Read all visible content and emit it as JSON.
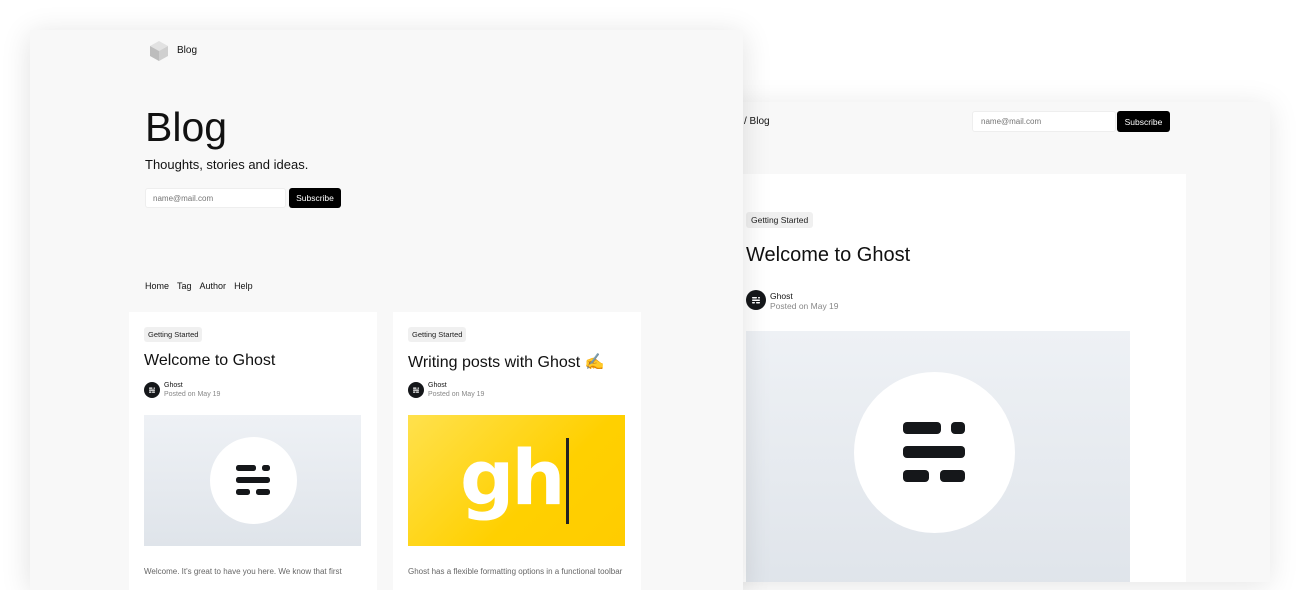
{
  "back_window": {
    "breadcrumb": "/ Blog",
    "subscribe": {
      "placeholder": "name@mail.com",
      "button": "Subscribe"
    },
    "post": {
      "tag": "Getting Started",
      "title": "Welcome to Ghost",
      "author": "Ghost",
      "date": "Posted on May 19",
      "image_icon": "ghost-logo-icon"
    }
  },
  "front_window": {
    "logo_icon": "cube-logo-icon",
    "logo_text": "Blog",
    "title": "Blog",
    "subtitle": "Thoughts, stories and ideas.",
    "subscribe": {
      "placeholder": "name@mail.com",
      "button": "Subscribe"
    },
    "nav": [
      "Home",
      "Tag",
      "Author",
      "Help"
    ],
    "posts": [
      {
        "tag": "Getting Started",
        "title": "Welcome to Ghost",
        "author": "Ghost",
        "date": "Posted on May 19",
        "image_icon": "ghost-logo-icon",
        "excerpt": "Welcome. It's great to have you here. We know that first"
      },
      {
        "tag": "Getting Started",
        "title": "Writing posts with Ghost ✍️",
        "author": "Ghost",
        "date": "Posted on May 19",
        "image_text": "gh",
        "excerpt": "Ghost has a flexible formatting options in a functional toolbar"
      }
    ]
  },
  "colors": {
    "page_bg": "#f8f8f8",
    "button_bg": "#000000",
    "avatar_bg": "#15171a",
    "gh_yellow": "#ffd000"
  }
}
